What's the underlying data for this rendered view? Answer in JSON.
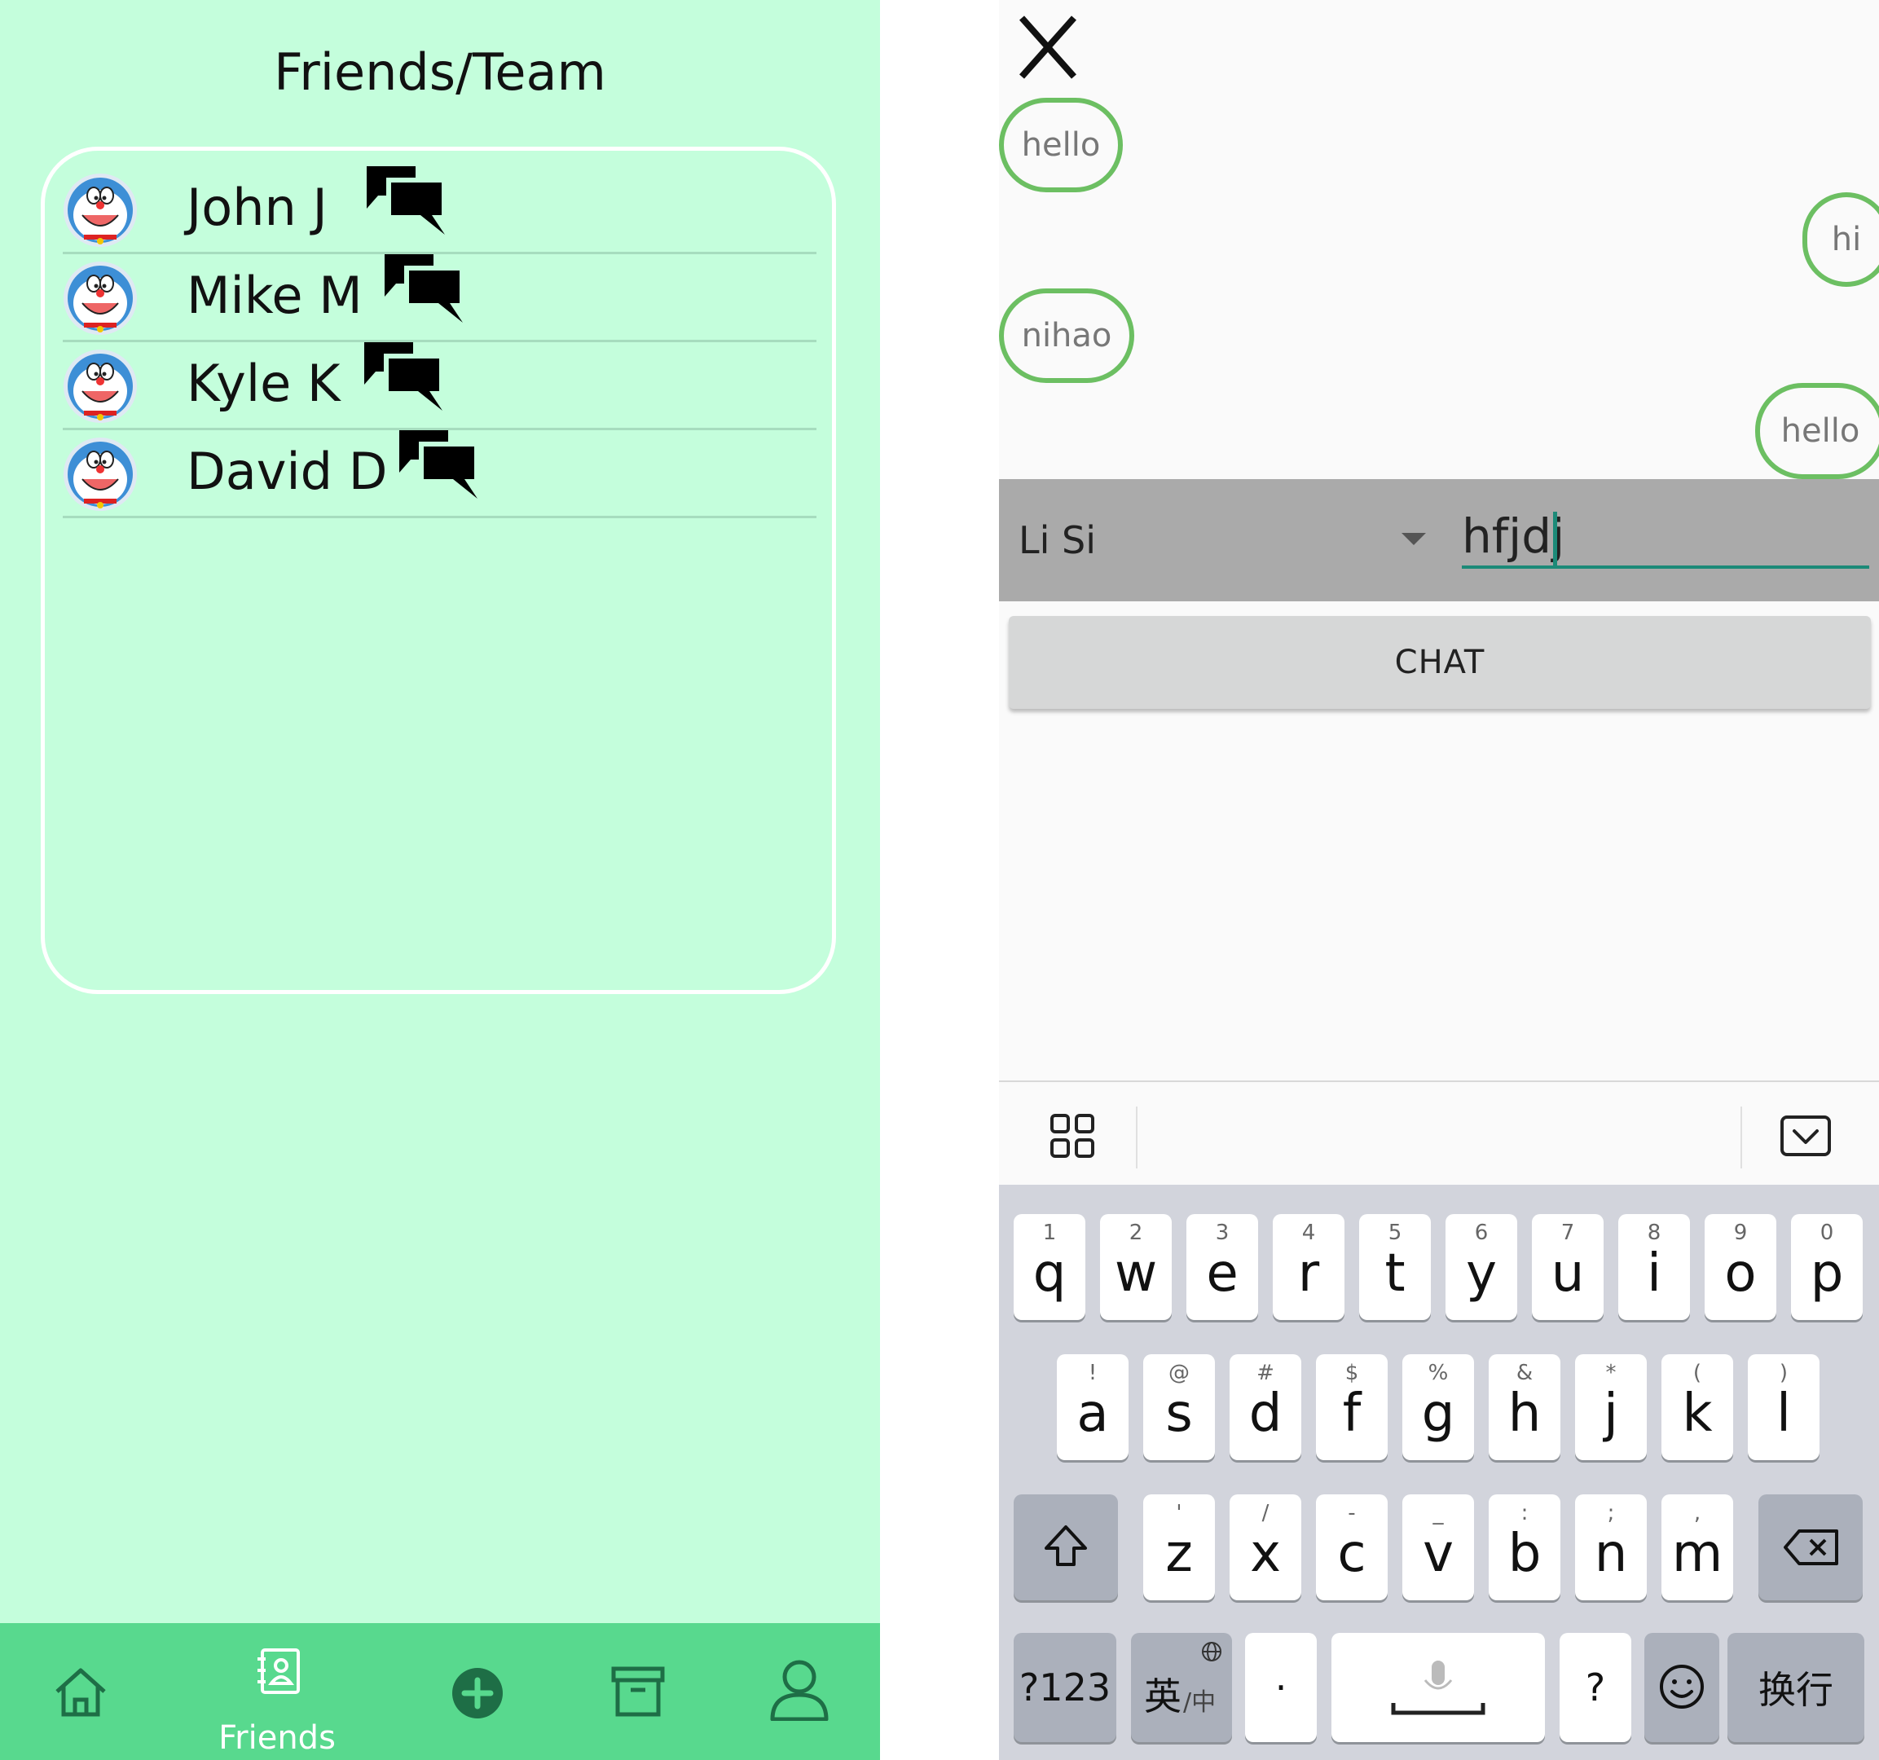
{
  "friends_screen": {
    "title": "Friends/Team",
    "friends": [
      {
        "name": "John J",
        "avatar_icon": "doraemon-avatar-icon",
        "action_icon": "chat-bubbles-icon"
      },
      {
        "name": "Mike M",
        "avatar_icon": "doraemon-avatar-icon",
        "action_icon": "chat-bubbles-icon"
      },
      {
        "name": "Kyle K",
        "avatar_icon": "doraemon-avatar-icon",
        "action_icon": "chat-bubbles-icon"
      },
      {
        "name": "David D",
        "avatar_icon": "doraemon-avatar-icon",
        "action_icon": "chat-bubbles-icon"
      }
    ],
    "bottom_nav": [
      {
        "icon": "home-icon",
        "label": ""
      },
      {
        "icon": "contacts-book-icon",
        "label": "Friends"
      },
      {
        "icon": "add-circle-icon",
        "label": ""
      },
      {
        "icon": "archive-box-icon",
        "label": ""
      },
      {
        "icon": "person-icon",
        "label": ""
      }
    ],
    "colors": {
      "background": "#c4fedc",
      "nav_background": "#58d98e",
      "card_border": "#ffffff"
    }
  },
  "chat_screen": {
    "close_label": "X",
    "messages": [
      {
        "text": "hello",
        "side": "left"
      },
      {
        "text": "hi",
        "side": "right"
      },
      {
        "text": "nihao",
        "side": "left"
      },
      {
        "text": "hello",
        "side": "right"
      }
    ],
    "recipient": "Li Si",
    "input_value": "hfjdj",
    "chat_button_label": "CHAT",
    "colors": {
      "bubble_border": "#6cbf62",
      "input_accent": "#1c8a78",
      "bar_background": "#aaaaaa"
    }
  },
  "keyboard": {
    "toolbar_icons": [
      "grid-apps-icon",
      "keyboard-hide-icon"
    ],
    "row1": [
      {
        "hint": "1",
        "key": "q"
      },
      {
        "hint": "2",
        "key": "w"
      },
      {
        "hint": "3",
        "key": "e"
      },
      {
        "hint": "4",
        "key": "r"
      },
      {
        "hint": "5",
        "key": "t"
      },
      {
        "hint": "6",
        "key": "y"
      },
      {
        "hint": "7",
        "key": "u"
      },
      {
        "hint": "8",
        "key": "i"
      },
      {
        "hint": "9",
        "key": "o"
      },
      {
        "hint": "0",
        "key": "p"
      }
    ],
    "row2": [
      {
        "hint": "!",
        "key": "a"
      },
      {
        "hint": "@",
        "key": "s"
      },
      {
        "hint": "#",
        "key": "d"
      },
      {
        "hint": "$",
        "key": "f"
      },
      {
        "hint": "%",
        "key": "g"
      },
      {
        "hint": "&",
        "key": "h"
      },
      {
        "hint": "*",
        "key": "j"
      },
      {
        "hint": "(",
        "key": "k"
      },
      {
        "hint": ")",
        "key": "l"
      }
    ],
    "row3": [
      {
        "hint": "'",
        "key": "z"
      },
      {
        "hint": "/",
        "key": "x"
      },
      {
        "hint": "-",
        "key": "c"
      },
      {
        "hint": "_",
        "key": "v"
      },
      {
        "hint": ":",
        "key": "b"
      },
      {
        "hint": ";",
        "key": "n"
      },
      {
        "hint": ",",
        "key": "m"
      }
    ],
    "shift_icon": "shift-arrow-icon",
    "backspace_icon": "backspace-icon",
    "bottom": {
      "numbers": "?123",
      "lang_main": "英",
      "lang_alt": "/中",
      "dot": "·",
      "space_icon": "microphone-icon",
      "question": "?",
      "emoji_icon": "emoji-smile-icon",
      "enter": "换行"
    }
  }
}
